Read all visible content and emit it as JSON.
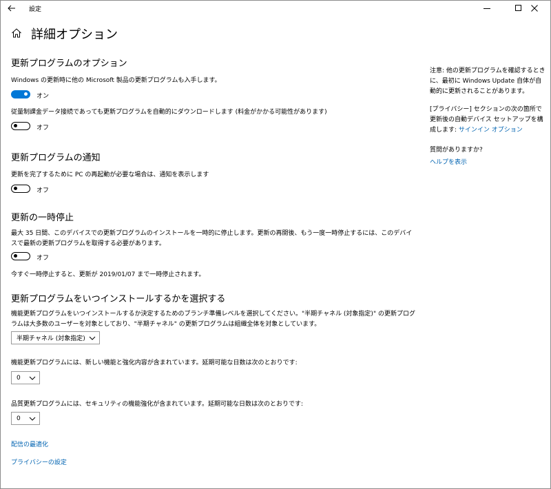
{
  "window": {
    "title": "設定",
    "back_icon": "back-arrow-icon",
    "minimize_icon": "minimize-icon",
    "maximize_icon": "maximize-icon",
    "close_icon": "close-icon"
  },
  "page": {
    "home_icon": "home-icon",
    "title": "詳細オプション"
  },
  "update_options": {
    "heading": "更新プログラムのオプション",
    "ms_products": {
      "label": "Windows の更新時に他の Microsoft 製品の更新プログラムも入手します。",
      "state": "オン"
    },
    "metered": {
      "label": "従量制課金データ接続であっても更新プログラムを自動的にダウンロードします (料金がかかる可能性があります)",
      "state": "オフ"
    }
  },
  "notifications": {
    "heading": "更新プログラムの通知",
    "restart": {
      "label": "更新を完了するために PC の再起動が必要な場合は、通知を表示します",
      "state": "オフ"
    }
  },
  "pause": {
    "heading": "更新の一時停止",
    "description": "最大 35 日間、このデバイスでの更新プログラムのインストールを一時的に停止します。更新の再開後、もう一度一時停止するには、このデバイスで最新の更新プログラムを取得する必要があります。",
    "state": "オフ",
    "note": "今すぐ一時停止すると、更新が 2019/01/07 まで一時停止されます。"
  },
  "schedule": {
    "heading": "更新プログラムをいつインストールするかを選択する",
    "description": "機能更新プログラムをいつインストールするか決定するためのブランチ準備レベルを選択してください。\"半期チャネル (対象指定)\" の更新プログラムは大多数のユーザーを対象としており、\"半期チャネル\" の更新プログラムは組織全体を対象としています。",
    "branch_value": "半期チャネル (対象指定)",
    "feature_label": "機能更新プログラムには、新しい機能と強化内容が含まれています。延期可能な日数は次のとおりです:",
    "feature_value": "0",
    "quality_label": "品質更新プログラムには、セキュリティの機能強化が含まれています。延期可能な日数は次のとおりです:",
    "quality_value": "0"
  },
  "links": {
    "delivery": "配信の最適化",
    "privacy": "プライバシーの設定"
  },
  "sidebar": {
    "note": "注意: 他の更新プログラムを確認するときに、最初に Windows Update 自体が自動的に更新されることがあります。",
    "privacy_text": "[プライバシー] セクションの次の箇所で更新後の自動デバイス セットアップを構成します:",
    "privacy_link": "サインイン オプション",
    "question": "質問がありますか?",
    "help_link": "ヘルプを表示"
  },
  "colors": {
    "accent": "#0078d7",
    "link": "#0063b1"
  }
}
